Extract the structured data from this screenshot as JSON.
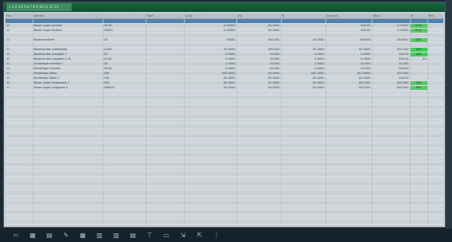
{
  "window": {
    "title": "» 1 2 3 4 5 6 7 8 9 10 11 12 13"
  },
  "table": {
    "columns": [
      "Pos",
      "Benefit",
      "",
      "Start",
      "Value",
      "Val",
      "N",
      "Amount",
      "Total",
      "N",
      "Mrs"
    ],
    "rows": [
      {
        "cells": [
          "",
          "",
          "",
          "",
          "",
          "",
          "",
          "",
          "",
          "",
          ""
        ],
        "selected": true,
        "badge": false
      },
      {
        "cells": [
          "11",
          "Boxen eigen eindloe",
          "00.00",
          "",
          "0.00000",
          "00.0000",
          "",
          "000.00",
          "0.00000",
          "0.00",
          ""
        ],
        "badge": true
      },
      {
        "cells": [
          "11",
          "Boxen eigen fanfare",
          "00000",
          "",
          "0.00000",
          "00.0000",
          "",
          "000.00",
          "0.00000",
          "0.00",
          ""
        ],
        "badge": true
      },
      {
        "cells": [
          "",
          "",
          "",
          "",
          "",
          "",
          "",
          "",
          "",
          "",
          ""
        ],
        "badge": false
      },
      {
        "cells": [
          "11",
          "Boxberechtfert",
          "00",
          "",
          "00000",
          "000.000",
          "00.0000",
          "000000",
          "00000.0",
          "000",
          ""
        ],
        "badge": true
      },
      {
        "cells": [
          "",
          "",
          "",
          "",
          "",
          "",
          "",
          "",
          "",
          "",
          ""
        ],
        "badge": false
      },
      {
        "cells": [
          "11",
          "Boxenlaufen vollständig",
          "0.000",
          "",
          "00.0000",
          "000.000",
          "00.0000",
          "00.0000",
          "000.000",
          "000",
          ""
        ],
        "badge": true,
        "strong": true
      },
      {
        "cells": [
          "11",
          "Boxenlaufen ausgabe 1",
          "00",
          "",
          "0.0000",
          "00.000",
          "0.0000",
          "0.0000",
          "000.00",
          "000",
          ""
        ],
        "badge": true,
        "strong": true
      },
      {
        "cells": [
          "11",
          "Boxenlaufen ausgabe 2 10",
          "00.00",
          "",
          "0.0000",
          "00.000",
          "0.0000",
          "0.0000",
          "000.00",
          "00",
          ""
        ],
        "badge": false
      },
      {
        "cells": [
          "11",
          "Dreiteiliger eindloe 1",
          "00",
          "",
          "0.0000",
          "00.000",
          "0.0000",
          "00.000",
          "00.000",
          "",
          ""
        ],
        "badge": false
      },
      {
        "cells": [
          "11",
          "Dreiteiliger eindloe",
          "00.00",
          "",
          "0.0000",
          "00.000",
          "0.0000",
          "00.000",
          "000.00",
          "",
          ""
        ],
        "badge": false
      },
      {
        "cells": [
          "11",
          "Dreiteilige Sätze",
          "000",
          "",
          "000.0000",
          "00.0000",
          "000.0000",
          "00.00000",
          "000.000",
          "",
          ""
        ],
        "badge": false
      },
      {
        "cells": [
          "11",
          "Dreiteilige Sätze 2",
          "000",
          "",
          "00.0000",
          "00.0000",
          "00.0000",
          "00.0000",
          "000.00",
          "",
          ""
        ],
        "badge": false
      },
      {
        "cells": [
          "11",
          "Boxen eigen Selbstwert 1",
          "000",
          "",
          "00.0000",
          "00.0000",
          "00.0000",
          "000.000",
          "000.000",
          "000",
          ""
        ],
        "badge": true
      },
      {
        "cells": [
          "11",
          "Boxen eigen Aufgaben 2",
          "000000",
          "",
          "00.0000",
          "00.0000",
          "00.0000",
          "000.000",
          "000.000",
          "000",
          ""
        ],
        "badge": true
      }
    ],
    "empty_rows": 30
  },
  "toolbar": {
    "tools": [
      {
        "icon": "arrow-left-icon",
        "glyph": "⇦"
      },
      {
        "icon": "grid-icon",
        "glyph": "▦"
      },
      {
        "icon": "sheet-icon",
        "glyph": "▤"
      },
      {
        "icon": "edit-icon",
        "glyph": "✎"
      },
      {
        "icon": "table-icon",
        "glyph": "▦"
      },
      {
        "icon": "chart-icon",
        "glyph": "▥"
      },
      {
        "icon": "columns-icon",
        "glyph": "▥"
      },
      {
        "icon": "list-icon",
        "glyph": "▤"
      },
      {
        "icon": "filter-icon",
        "glyph": "⊤"
      },
      {
        "icon": "print-icon",
        "glyph": "▭"
      },
      {
        "icon": "export-icon",
        "glyph": "⇲"
      },
      {
        "icon": "import-icon",
        "glyph": "⇱"
      },
      {
        "icon": "more-icon",
        "glyph": "⋮"
      }
    ]
  }
}
